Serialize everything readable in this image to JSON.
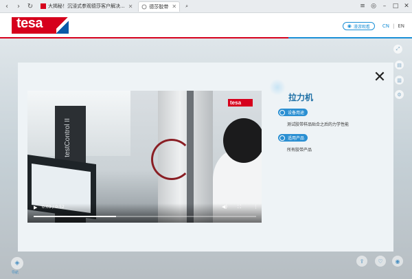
{
  "browser": {
    "tabs": [
      {
        "label": "大揭秘！沉浸式参观德莎客户解决...",
        "active": false
      },
      {
        "label": "德莎胶带",
        "active": true
      }
    ],
    "nav_icons": [
      "back-icon",
      "forward-icon",
      "reload-icon"
    ]
  },
  "header": {
    "logo_text": "tesa",
    "browse_label": "漫游观看",
    "lang_cn": "CN",
    "lang_sep": "|",
    "lang_en": "EN"
  },
  "modal": {
    "title": "拉力机",
    "sections": [
      {
        "badge": "设备用途",
        "text": "测试胶带样品贴合之后的力学性能"
      },
      {
        "badge": "适用产品",
        "text": "所有胶带产品"
      }
    ]
  },
  "video": {
    "time": "0:03 / 0:52",
    "progress": 0.37,
    "cabinet_text": "testControl II",
    "logo_text": "tesa"
  },
  "bottom": {
    "left_label": "导航"
  },
  "colors": {
    "brand_red": "#d6001c",
    "accent_blue": "#1a8fd6"
  }
}
